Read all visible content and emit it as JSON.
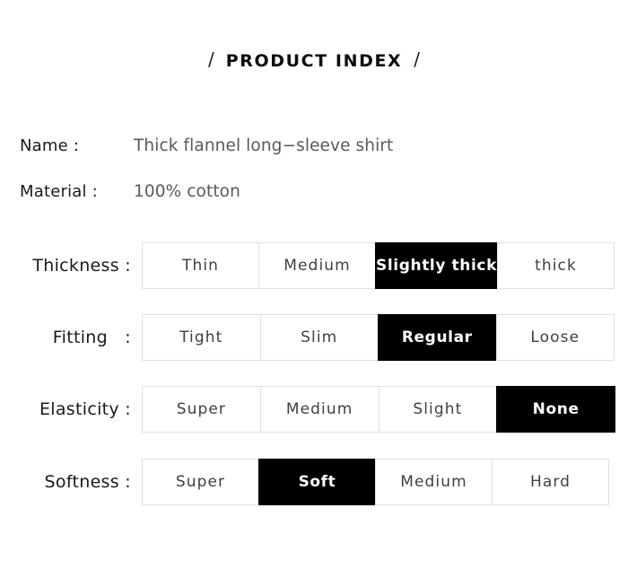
{
  "header": {
    "left_slash": "/",
    "title": "PRODUCT INDEX",
    "right_slash": "/"
  },
  "info": [
    {
      "label": "Name :",
      "value": "Thick flannel long−sleeve shirt"
    },
    {
      "label": "Material :",
      "value": "100% cotton"
    }
  ],
  "options": [
    {
      "label": "Thickness :",
      "selected_index": 2,
      "choices": [
        "Thin",
        "Medium",
        "Slightly thick",
        "thick"
      ],
      "selected_value": "Slightly thick"
    },
    {
      "label": "Fitting :",
      "selected_index": 2,
      "choices": [
        "Tight",
        "Slim",
        "Regular",
        "Loose"
      ],
      "selected_value": "Regular"
    },
    {
      "label": "Elasticity :",
      "selected_index": 3,
      "choices": [
        "Super",
        "Medium",
        "Slight",
        "None"
      ],
      "selected_value": "None"
    },
    {
      "label": "Softness :",
      "selected_index": 1,
      "choices": [
        "Super",
        "Soft",
        "Medium",
        "Hard"
      ],
      "selected_value": "Soft"
    }
  ],
  "colors": {
    "selected_background": "#000000",
    "selected_text": "#ffffff",
    "cell_border": "#e0e0e0",
    "cell_text": "#3f3f3f",
    "label_text": "#1a1a1a",
    "value_text": "#595959",
    "page_background": "#ffffff"
  }
}
